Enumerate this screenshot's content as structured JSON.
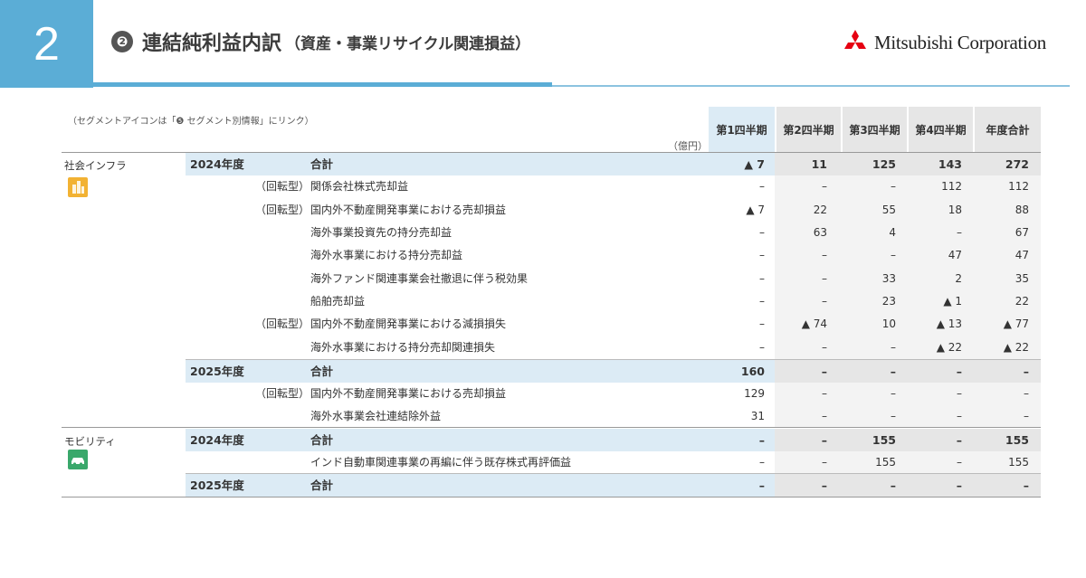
{
  "page_number": "2",
  "title": {
    "circle": "❷",
    "main": "連結純利益内訳",
    "sub": "（資産・事業リサイクル関連損益）"
  },
  "logo": {
    "text": "Mitsubishi Corporation",
    "icon": "three-diamonds-logo",
    "color": "#e60012"
  },
  "note": "（セグメントアイコンは「❺ セグメント別情報」にリンク）",
  "unit": "（億円）",
  "columns": [
    "第1四半期",
    "第2四半期",
    "第3四半期",
    "第4四半期",
    "年度合計"
  ],
  "segments": [
    {
      "name": "社会インフラ",
      "icon": "infrastructure-icon",
      "icon_color": "#f2b233"
    },
    {
      "name": "モビリティ",
      "icon": "car-icon",
      "icon_color": "#3aa86b"
    }
  ],
  "rows": [
    {
      "year": "2024年度",
      "tag": "",
      "item": "合計",
      "q1": "▲ 7",
      "q2": "11",
      "q3": "125",
      "q4": "143",
      "fy": "272"
    },
    {
      "year": "",
      "tag": "（回転型）",
      "item": "関係会社株式売却益",
      "q1": "–",
      "q2": "–",
      "q3": "–",
      "q4": "112",
      "fy": "112"
    },
    {
      "year": "",
      "tag": "（回転型）",
      "item": "国内外不動産開発事業における売却損益",
      "q1": "▲ 7",
      "q2": "22",
      "q3": "55",
      "q4": "18",
      "fy": "88"
    },
    {
      "year": "",
      "tag": "",
      "item": "海外事業投資先の持分売却益",
      "q1": "–",
      "q2": "63",
      "q3": "4",
      "q4": "–",
      "fy": "67"
    },
    {
      "year": "",
      "tag": "",
      "item": "海外水事業における持分売却益",
      "q1": "–",
      "q2": "–",
      "q3": "–",
      "q4": "47",
      "fy": "47"
    },
    {
      "year": "",
      "tag": "",
      "item": "海外ファンド関連事業会社撤退に伴う税効果",
      "q1": "–",
      "q2": "–",
      "q3": "33",
      "q4": "2",
      "fy": "35"
    },
    {
      "year": "",
      "tag": "",
      "item": "船舶売却益",
      "q1": "–",
      "q2": "–",
      "q3": "23",
      "q4": "▲ 1",
      "fy": "22"
    },
    {
      "year": "",
      "tag": "（回転型）",
      "item": "国内外不動産開発事業における減損損失",
      "q1": "–",
      "q2": "▲ 74",
      "q3": "10",
      "q4": "▲ 13",
      "fy": "▲ 77"
    },
    {
      "year": "",
      "tag": "",
      "item": "海外水事業における持分売却関連損失",
      "q1": "–",
      "q2": "–",
      "q3": "–",
      "q4": "▲ 22",
      "fy": "▲ 22"
    },
    {
      "year": "2025年度",
      "tag": "",
      "item": "合計",
      "q1": "160",
      "q2": "–",
      "q3": "–",
      "q4": "–",
      "fy": "–"
    },
    {
      "year": "",
      "tag": "（回転型）",
      "item": "国内外不動産開発事業における売却損益",
      "q1": "129",
      "q2": "–",
      "q3": "–",
      "q4": "–",
      "fy": "–"
    },
    {
      "year": "",
      "tag": "",
      "item": "海外水事業会社連結除外益",
      "q1": "31",
      "q2": "–",
      "q3": "–",
      "q4": "–",
      "fy": "–"
    },
    {
      "year": "2024年度",
      "tag": "",
      "item": "合計",
      "q1": "–",
      "q2": "–",
      "q3": "155",
      "q4": "–",
      "fy": "155"
    },
    {
      "year": "",
      "tag": "",
      "item": "インド自動車関連事業の再編に伴う既存株式再評価益",
      "q1": "–",
      "q2": "–",
      "q3": "155",
      "q4": "–",
      "fy": "155"
    },
    {
      "year": "2025年度",
      "tag": "",
      "item": "合計",
      "q1": "–",
      "q2": "–",
      "q3": "–",
      "q4": "–",
      "fy": "–"
    }
  ]
}
